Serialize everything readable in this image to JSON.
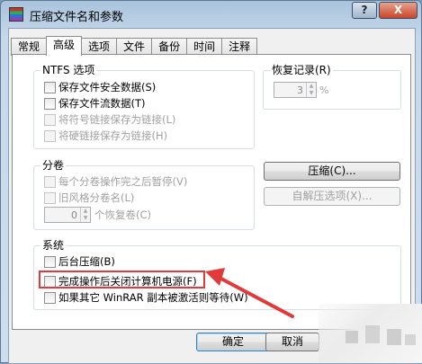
{
  "window": {
    "title": "压缩文件名和参数",
    "help_label": "?",
    "close_label": "X"
  },
  "tabs": [
    "常规",
    "高级",
    "选项",
    "文件",
    "备份",
    "时间",
    "注释"
  ],
  "ntfs": {
    "label": "NTFS 选项",
    "items": [
      {
        "label": "保存文件安全数据(S)",
        "enabled": true
      },
      {
        "label": "保存文件流数据(T)",
        "enabled": true
      },
      {
        "label": "将符号链接保存为链接(L)",
        "enabled": false
      },
      {
        "label": "将硬链接保存为链接(H)",
        "enabled": false
      }
    ]
  },
  "recovery": {
    "label": "恢复记录(R)",
    "value": "3",
    "unit": "%"
  },
  "volume": {
    "label": "分卷",
    "items": [
      {
        "label": "每个分卷操作完之后暂停(V)",
        "enabled": false
      },
      {
        "label": "旧风格分卷名(L)",
        "enabled": false
      }
    ],
    "recovery_vol_value": "0",
    "recovery_vol_label": "个恢复卷(C)"
  },
  "buttons": {
    "compress": "压缩(C)...",
    "sfx_options": "自解压选项(X)...",
    "ok": "确定",
    "cancel": "取消"
  },
  "system": {
    "label": "系统",
    "items": [
      {
        "label": "后台压缩(B)",
        "enabled": true
      },
      {
        "label": "完成操作后关闭计算机电源(F)",
        "enabled": true
      },
      {
        "label": "如果其它 WinRAR 副本被激活则等待(W)",
        "enabled": true
      }
    ]
  },
  "annotation": {
    "highlight_color": "#e03a3a"
  }
}
